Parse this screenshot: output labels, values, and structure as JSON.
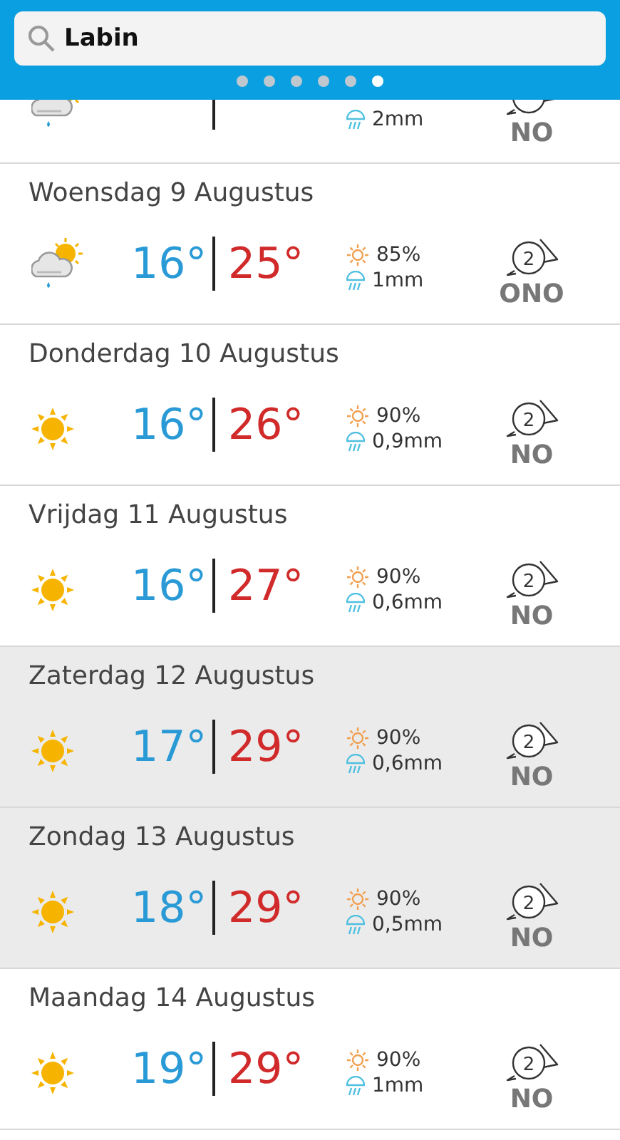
{
  "search": {
    "value": "Labin"
  },
  "pages": [
    {
      "selected": false
    },
    {
      "selected": false
    },
    {
      "selected": false
    },
    {
      "selected": false
    },
    {
      "selected": false
    },
    {
      "selected": true
    }
  ],
  "days": [
    {
      "kind": "cloud-sun-rain",
      "rain": "2mm",
      "wind": "NO",
      "weekend": false
    },
    {
      "date": "Woensdag 9 Augustus",
      "kind": "cloud-sun-rain",
      "min": "16°",
      "max": "25°",
      "sun": "85%",
      "rain": "1mm",
      "wind_force": "2",
      "wind": "ONO",
      "weekend": false
    },
    {
      "date": "Donderdag 10 Augustus",
      "kind": "sun",
      "min": "16°",
      "max": "26°",
      "sun": "90%",
      "rain": "0,9mm",
      "wind_force": "2",
      "wind": "NO",
      "weekend": false
    },
    {
      "date": "Vrijdag 11 Augustus",
      "kind": "sun",
      "min": "16°",
      "max": "27°",
      "sun": "90%",
      "rain": "0,6mm",
      "wind_force": "2",
      "wind": "NO",
      "weekend": false
    },
    {
      "date": "Zaterdag 12 Augustus",
      "kind": "sun",
      "min": "17°",
      "max": "29°",
      "sun": "90%",
      "rain": "0,6mm",
      "wind_force": "2",
      "wind": "NO",
      "weekend": true
    },
    {
      "date": "Zondag 13 Augustus",
      "kind": "sun",
      "min": "18°",
      "max": "29°",
      "sun": "90%",
      "rain": "0,5mm",
      "wind_force": "2",
      "wind": "NO",
      "weekend": true
    },
    {
      "date": "Maandag 14 Augustus",
      "kind": "sun",
      "min": "19°",
      "max": "29°",
      "sun": "90%",
      "rain": "1mm",
      "wind_force": "2",
      "wind": "NO",
      "weekend": false
    }
  ]
}
